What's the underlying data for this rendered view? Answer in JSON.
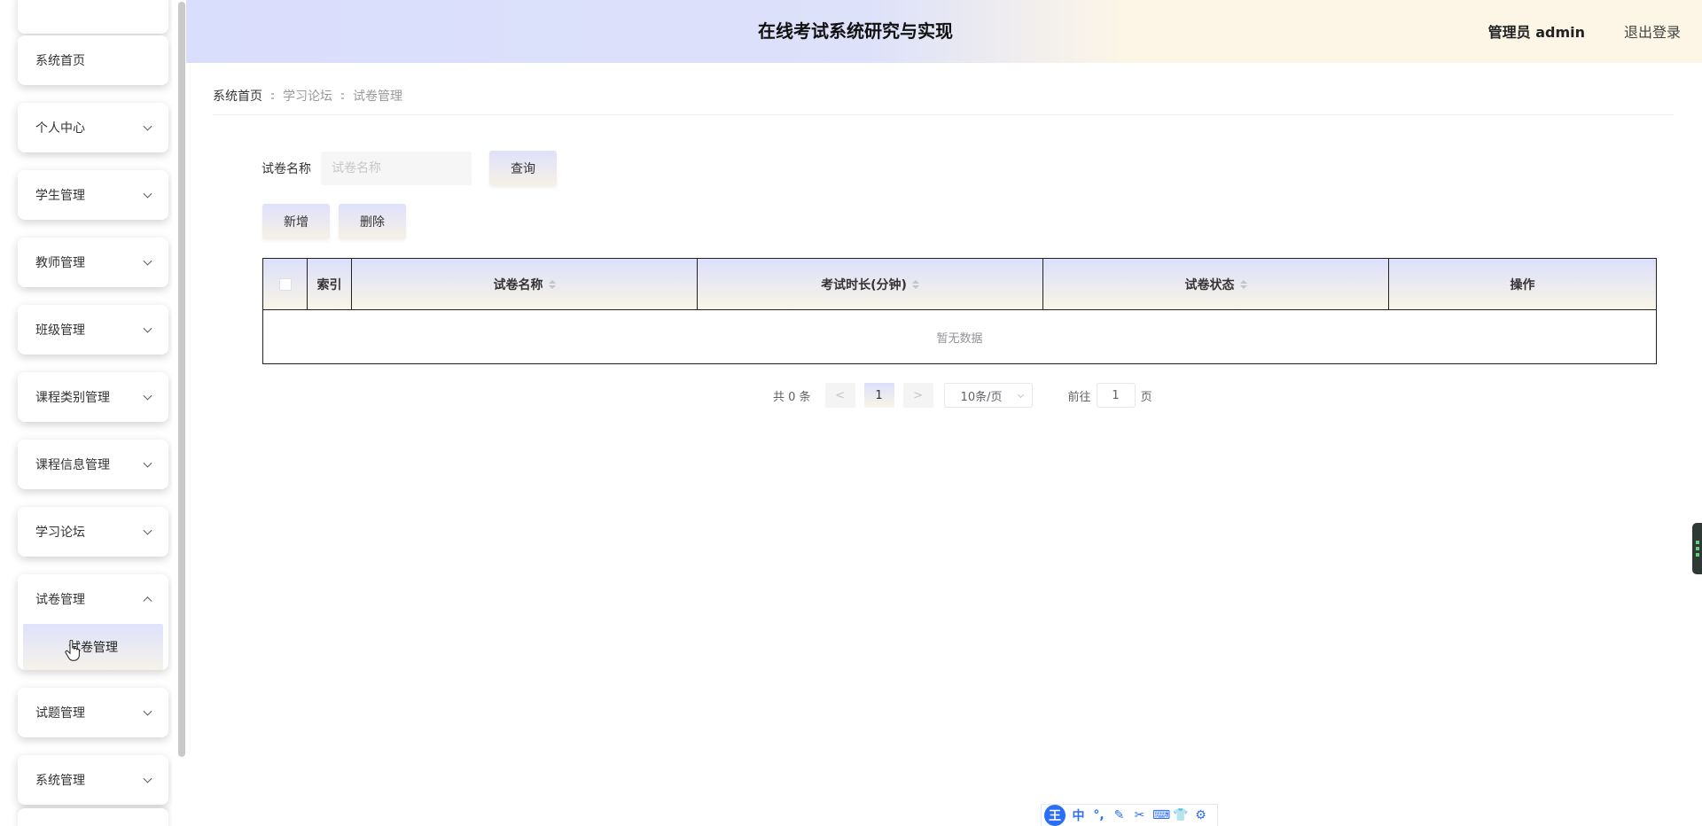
{
  "header": {
    "title": "在线考试系统研究与实现",
    "user": "管理员 admin",
    "logout": "退出登录"
  },
  "sidebar": {
    "items": [
      {
        "label": "系统首页"
      },
      {
        "label": "个人中心"
      },
      {
        "label": "学生管理"
      },
      {
        "label": "教师管理"
      },
      {
        "label": "班级管理"
      },
      {
        "label": "课程类别管理"
      },
      {
        "label": "课程信息管理"
      },
      {
        "label": "学习论坛"
      },
      {
        "label": "试卷管理",
        "expanded": true,
        "children": [
          {
            "label": "试卷管理"
          }
        ]
      },
      {
        "label": "试题管理"
      },
      {
        "label": "系统管理"
      }
    ]
  },
  "breadcrumb": [
    "系统首页",
    "学习论坛",
    "试卷管理"
  ],
  "search": {
    "label": "试卷名称",
    "placeholder": "试卷名称",
    "value": "",
    "button": "查询"
  },
  "actions": {
    "add": "新增",
    "delete": "删除"
  },
  "table": {
    "columns": [
      "",
      "索引",
      "试卷名称",
      "考试时长(分钟)",
      "试卷状态",
      "操作"
    ],
    "rows": [],
    "empty_text": "暂无数据"
  },
  "pagination": {
    "total_text": "共 0 条",
    "prev": "<",
    "next": ">",
    "current_page": "1",
    "page_size": "10条/页",
    "goto_label": "前往",
    "goto_value": "1",
    "goto_suffix": "页"
  },
  "ime_toolbar": {
    "logo": "王",
    "mode": "中",
    "icons": [
      "punctuation-icon",
      "pen-icon",
      "scissors-icon",
      "keyboard-icon",
      "shirt-icon",
      "gear-icon"
    ]
  },
  "colors": {
    "accent_gradient_start": "#dcdffb",
    "accent_gradient_end": "#f9f5e6",
    "ime_blue": "#2b6ef5"
  }
}
